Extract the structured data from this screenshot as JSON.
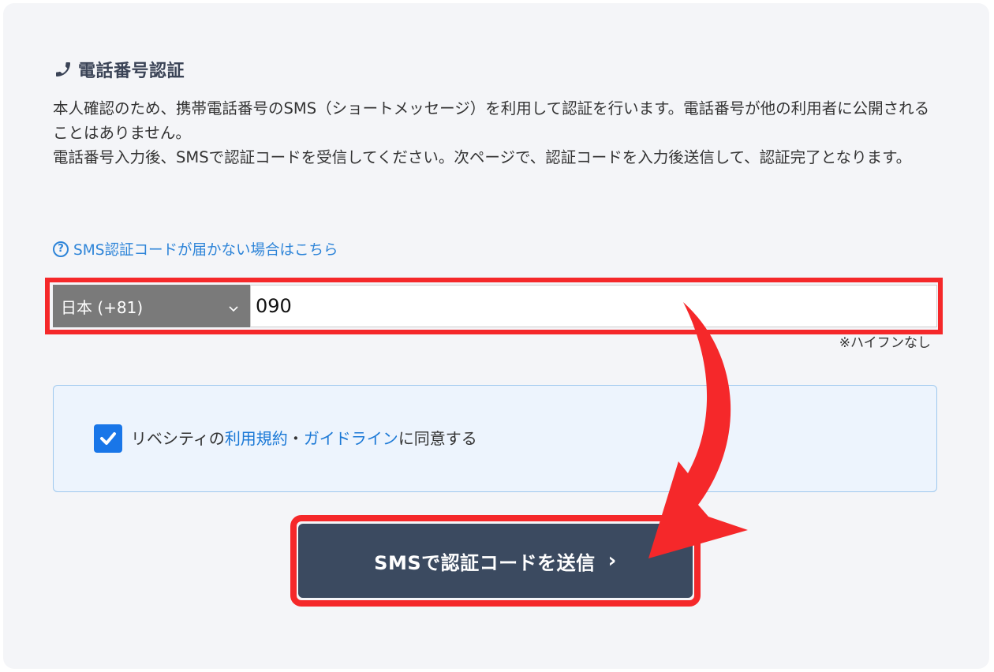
{
  "section": {
    "title": "電話番号認証",
    "icon": "phone-icon"
  },
  "description": {
    "line1": "本人確認のため、携帯電話番号のSMS（ショートメッセージ）を利用して認証を行います。電話番号が他の利用者に公開されることはありません。",
    "line2": "電話番号入力後、SMSで認証コードを受信してください。次ページで、認証コードを入力後送信して、認証完了となります。"
  },
  "help_link": {
    "label": "SMS認証コードが届かない場合はこちら",
    "icon": "question-circle-icon"
  },
  "phone": {
    "country_selected": "日本 (+81)",
    "value": "090",
    "note": "※ハイフンなし"
  },
  "agreement": {
    "checked": true,
    "prefix": "リベシティの",
    "terms_link": "利用規約",
    "separator": "・",
    "guideline_link": "ガイドライン",
    "suffix": "に同意する"
  },
  "submit": {
    "label": "SMSで認証コードを送信",
    "icon": "chevron-right-icon"
  },
  "colors": {
    "highlight_red": "#f5282a",
    "link_blue": "#2d84d8",
    "button_navy": "#3b4a60",
    "checkbox_blue": "#1976e8"
  }
}
